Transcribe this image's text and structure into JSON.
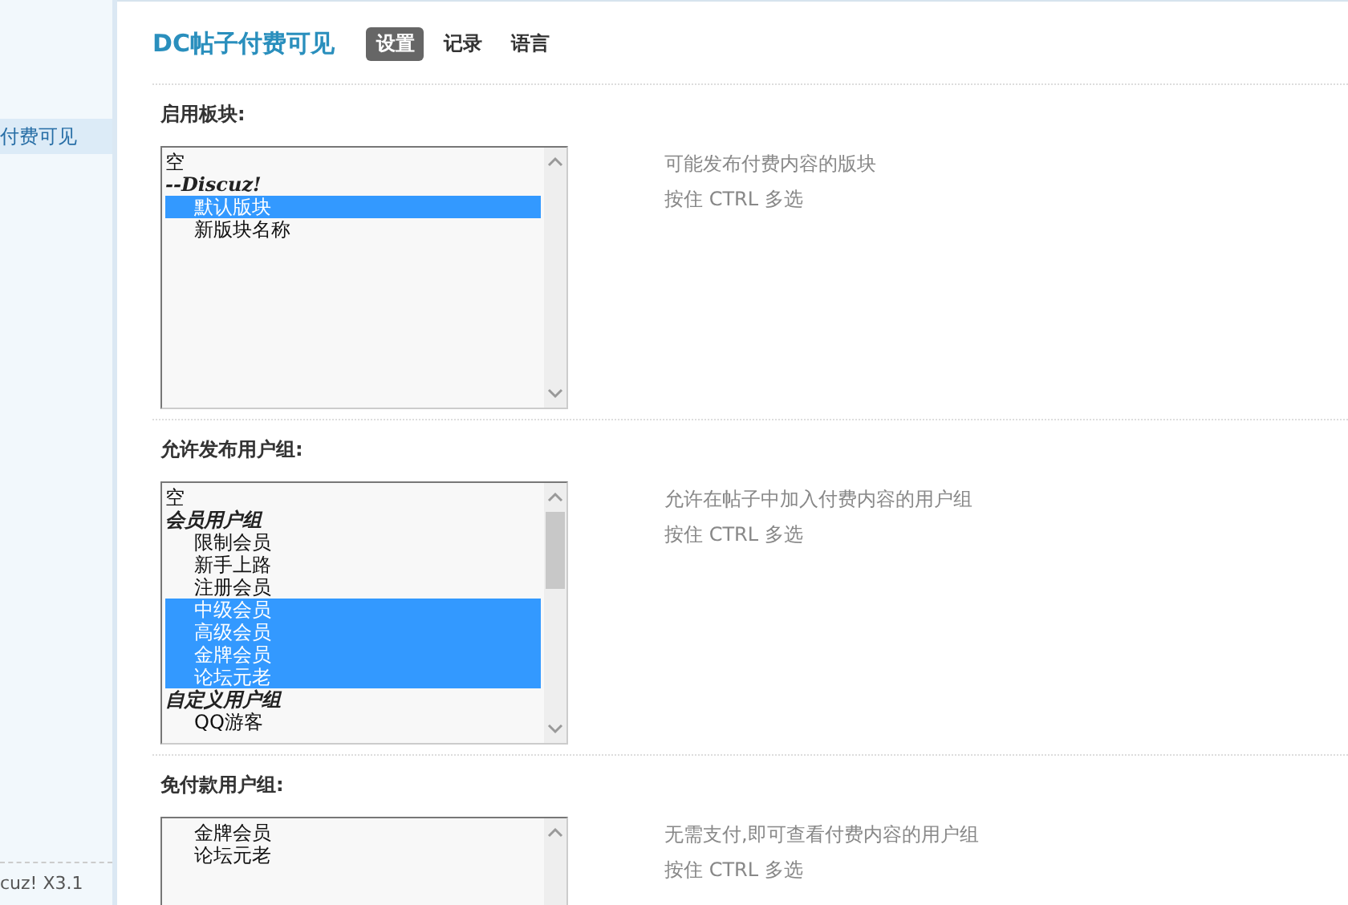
{
  "sidebar": {
    "items": [
      {
        "label": "付费可见",
        "selected": true
      }
    ],
    "footer": "cuz! X3.1"
  },
  "header": {
    "title": "DC帖子付费可见",
    "tabs": [
      {
        "label": "设置",
        "selected": true
      },
      {
        "label": "记录",
        "selected": false
      },
      {
        "label": "语言",
        "selected": false
      }
    ]
  },
  "sections": [
    {
      "label": "启用板块:",
      "options": [
        {
          "label": "空",
          "selected": false
        },
        {
          "label": "--Discuz!",
          "kind": "group",
          "children": [
            {
              "label": "默认版块",
              "selected": true
            },
            {
              "label": "新版块名称",
              "selected": false
            }
          ]
        }
      ],
      "hints": [
        "可能发布付费内容的版块",
        "按住 CTRL 多选"
      ]
    },
    {
      "label": "允许发布用户组:",
      "options": [
        {
          "label": "空",
          "selected": false
        },
        {
          "label": "会员用户组",
          "kind": "group",
          "children": [
            {
              "label": "限制会员",
              "selected": false
            },
            {
              "label": "新手上路",
              "selected": false
            },
            {
              "label": "注册会员",
              "selected": false
            },
            {
              "label": "中级会员",
              "selected": true
            },
            {
              "label": "高级会员",
              "selected": true
            },
            {
              "label": "金牌会员",
              "selected": true
            },
            {
              "label": "论坛元老",
              "selected": true
            }
          ]
        },
        {
          "label": "自定义用户组",
          "kind": "group",
          "children": [
            {
              "label": "QQ游客",
              "selected": false
            }
          ]
        }
      ],
      "hints": [
        "允许在帖子中加入付费内容的用户组",
        "按住 CTRL 多选"
      ]
    },
    {
      "label": "免付款用户组:",
      "options": [
        {
          "label": "金牌会员",
          "selected": false
        },
        {
          "label": "论坛元老",
          "selected": false
        }
      ],
      "hints": [
        "无需支付,即可查看付费内容的用户组",
        "按住 CTRL 多选"
      ]
    }
  ]
}
